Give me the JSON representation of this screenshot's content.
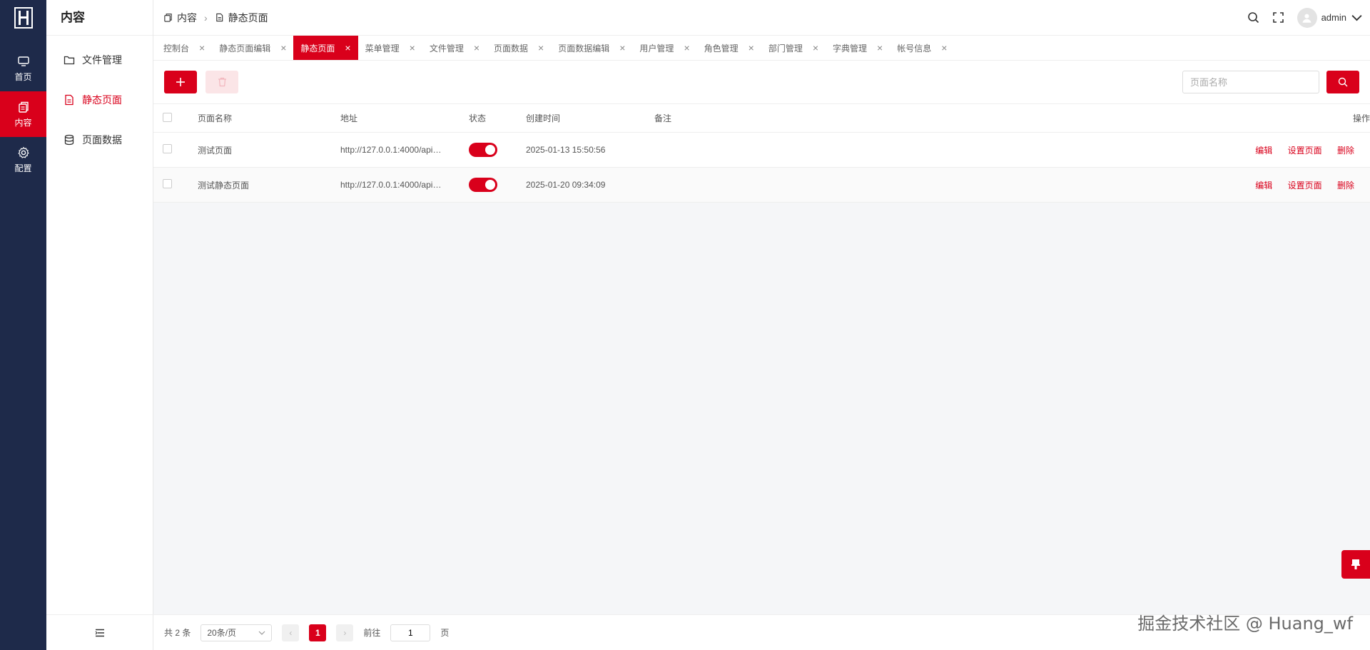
{
  "colors": {
    "accent": "#d9001b",
    "rail_bg": "#1e2a4a"
  },
  "rail": {
    "items": [
      {
        "label": "首页",
        "icon": "monitor-icon"
      },
      {
        "label": "内容",
        "icon": "copy-icon",
        "active": true
      },
      {
        "label": "配置",
        "icon": "gear-icon"
      }
    ]
  },
  "sidebar": {
    "title": "内容",
    "items": [
      {
        "label": "文件管理",
        "icon": "folder-icon"
      },
      {
        "label": "静态页面",
        "icon": "document-icon",
        "active": true
      },
      {
        "label": "页面数据",
        "icon": "database-icon"
      }
    ]
  },
  "header": {
    "breadcrumb": [
      "内容",
      "静态页面"
    ],
    "username": "admin"
  },
  "tabs": [
    {
      "label": "控制台"
    },
    {
      "label": "静态页面编辑"
    },
    {
      "label": "静态页面",
      "active": true
    },
    {
      "label": "菜单管理"
    },
    {
      "label": "文件管理"
    },
    {
      "label": "页面数据"
    },
    {
      "label": "页面数据编辑"
    },
    {
      "label": "用户管理"
    },
    {
      "label": "角色管理"
    },
    {
      "label": "部门管理"
    },
    {
      "label": "字典管理"
    },
    {
      "label": "帐号信息"
    }
  ],
  "toolbar": {
    "search_placeholder": "页面名称"
  },
  "table": {
    "columns": [
      "页面名称",
      "地址",
      "状态",
      "创建时间",
      "备注",
      "操作"
    ],
    "rows": [
      {
        "name": "测试页面",
        "address": "http://127.0.0.1:4000/api…",
        "status": true,
        "created": "2025-01-13 15:50:56",
        "remark": ""
      },
      {
        "name": "测试静态页面",
        "address": "http://127.0.0.1:4000/api…",
        "status": true,
        "created": "2025-01-20 09:34:09",
        "remark": ""
      }
    ],
    "actions": [
      "编辑",
      "设置页面",
      "删除"
    ]
  },
  "pager": {
    "total": "共 2 条",
    "page_size": "20条/页",
    "current_page": "1",
    "goto_label": "前往",
    "goto_value": "1",
    "page_suffix": "页"
  },
  "watermark": "掘金技术社区 @ Huang_wf"
}
